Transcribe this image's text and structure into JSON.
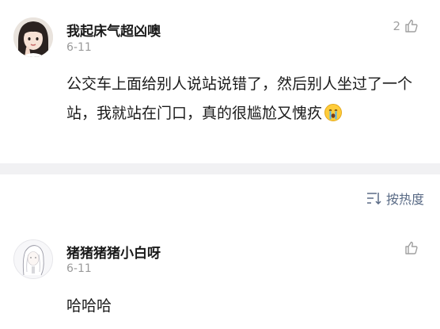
{
  "comments": [
    {
      "username": "我起床气超凶噢",
      "date": "6-11",
      "likes": "2",
      "text": "公交车上面给别人说站说错了，然后别人坐过了一个站，我就站在门口，真的很尴尬又愧疚",
      "emoji": "crying-face"
    },
    {
      "username": "猪猪猪猪小白呀",
      "date": "6-11",
      "likes": "",
      "text": "哈哈哈"
    }
  ],
  "sort": {
    "label": "按热度"
  },
  "colors": {
    "username": "#1a1a1a",
    "date": "#9a9a9a",
    "sort_text": "#5a6b86",
    "divider": "#f1f1f3"
  }
}
